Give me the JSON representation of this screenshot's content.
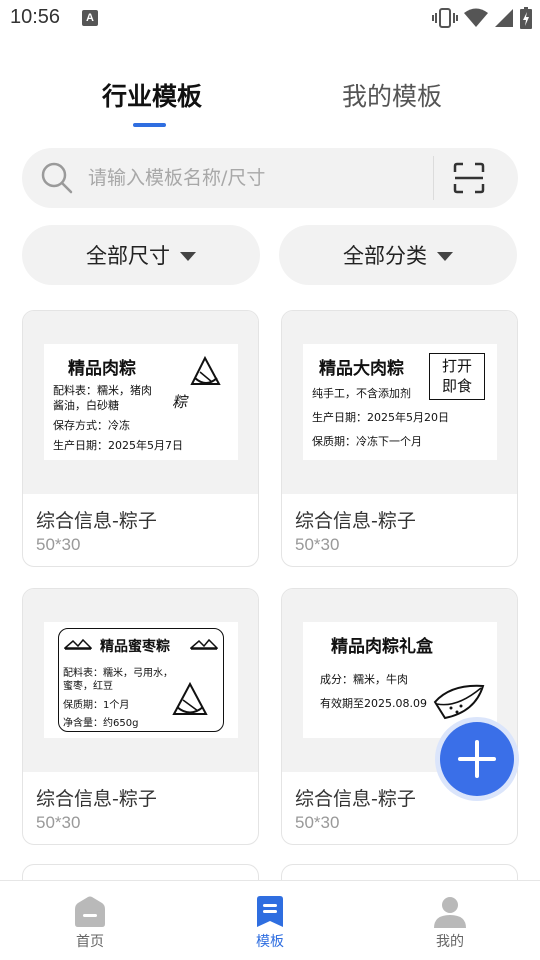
{
  "status_bar": {
    "time": "10:56",
    "notification_glyph": "A"
  },
  "tabs": [
    {
      "label": "行业模板",
      "active": true
    },
    {
      "label": "我的模板",
      "active": false
    }
  ],
  "search": {
    "placeholder": "请输入模板名称/尺寸",
    "value": ""
  },
  "filters": {
    "size_label": "全部尺寸",
    "category_label": "全部分类"
  },
  "templates": [
    {
      "title": "综合信息-粽子",
      "size": "50*30",
      "label": {
        "heading": "精品肉粽",
        "lines": [
          "配料表：糯米，猪肉",
          "酱油，白砂糖",
          "保存方式：冷冻",
          "生产日期：2025年5月7日"
        ],
        "stamp": "粽"
      }
    },
    {
      "title": "综合信息-粽子",
      "size": "50*30",
      "label": {
        "heading": "精品大肉粽",
        "box_text": [
          "打开",
          "即食"
        ],
        "lines": [
          "纯手工，不含添加剂",
          "生产日期：2025年5月20日",
          "保质期：冷冻下一个月"
        ]
      }
    },
    {
      "title": "综合信息-粽子",
      "size": "50*30",
      "label": {
        "heading": "精品蜜枣粽",
        "lines": [
          "配料表：糯米，弓用水，",
          "蜜枣，红豆",
          "保质期：1个月",
          "净含量：约650g"
        ]
      }
    },
    {
      "title": "综合信息-粽子",
      "size": "50*30",
      "label": {
        "heading": "精品肉粽礼盒",
        "lines": [
          "成分：糯米，牛肉",
          "有效期至2025.08.09"
        ]
      }
    }
  ],
  "bottom_nav": [
    {
      "label": "首页",
      "icon": "home-icon",
      "active": false
    },
    {
      "label": "模板",
      "icon": "template-icon",
      "active": true
    },
    {
      "label": "我的",
      "icon": "profile-icon",
      "active": false
    }
  ],
  "colors": {
    "accent": "#2f6ee0",
    "fab": "#3a6fe8",
    "chip_bg": "#f2f2f2"
  }
}
